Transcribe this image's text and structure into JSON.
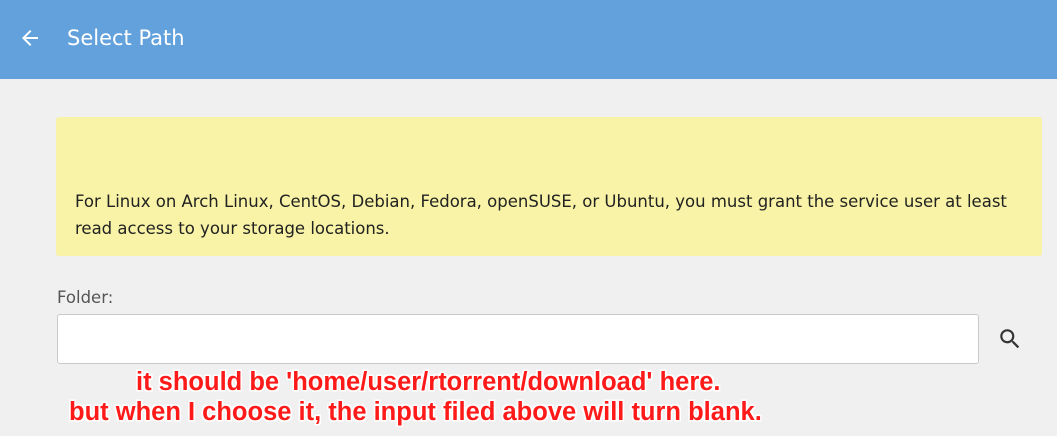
{
  "header": {
    "title": "Select Path",
    "back_icon": "arrow-left-icon",
    "background_color": "#62a1dc"
  },
  "notice": {
    "text": "For Linux on Arch Linux, CentOS, Debian, Fedora, openSUSE, or Ubuntu, you must grant the service user at least read access to your storage locations.",
    "background_color": "#f8f3a6"
  },
  "folder": {
    "label": "Folder:",
    "value": "",
    "placeholder": "",
    "search_icon": "search-icon"
  },
  "annotations": {
    "line1": "it should be 'home/user/rtorrent/download' here.",
    "line2": "but when I choose it, the input filed above will turn blank.",
    "color": "#ff1a1a"
  }
}
